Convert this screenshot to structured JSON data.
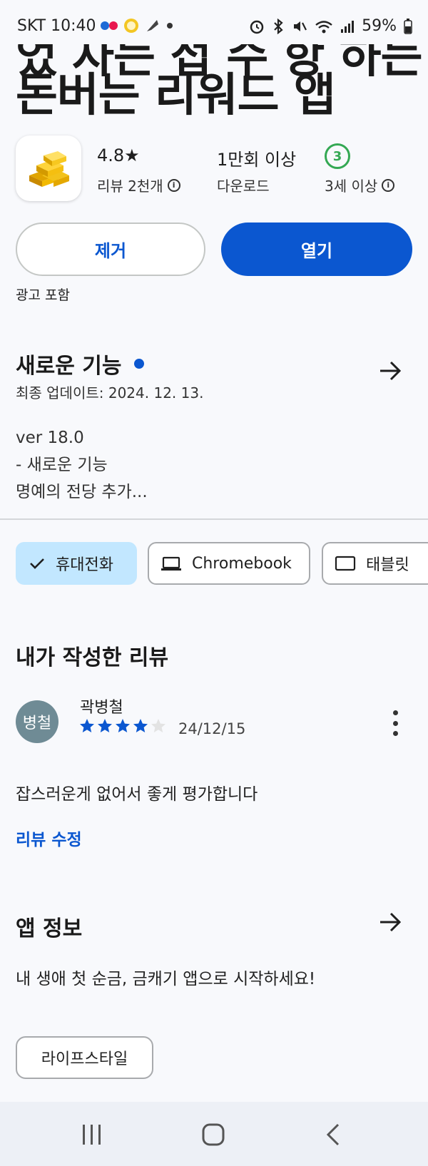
{
  "status_bar": {
    "carrier_time": "SKT 10:40",
    "battery": "59%"
  },
  "app": {
    "title_line1": "었 자는 접 수 항 하는",
    "title_line2": "돈버는 리워드 앱",
    "icon": "gold-bars-icon"
  },
  "stats": {
    "rating": "4.8★",
    "reviews": "리뷰 2천개",
    "downloads": "1만회 이상",
    "downloads_label": "다운로드",
    "age_number": "3",
    "age_label": "3세 이상"
  },
  "actions": {
    "remove_label": "제거",
    "open_label": "열기"
  },
  "ads_label": "광고 포함",
  "whats_new": {
    "title": "새로운 기능",
    "updated": "최종 업데이트: 2024. 12. 13.",
    "notes": [
      "ver 18.0",
      "- 새로운 기능",
      "명예의 전당 추가..."
    ]
  },
  "device_chips": [
    {
      "label": "휴대전화",
      "selected": true,
      "icon": "check-icon"
    },
    {
      "label": "Chromebook",
      "selected": false,
      "icon": "laptop-icon"
    },
    {
      "label": "태블릿",
      "selected": false,
      "icon": "tablet-icon"
    }
  ],
  "my_review": {
    "title": "내가 작성한 리뷰",
    "avatar_text": "병철",
    "reviewer": "곽병철",
    "rating": 4,
    "max_rating": 5,
    "date": "24/12/15",
    "text": "잡스러운게 없어서 좋게 평가합니다",
    "edit_label": "리뷰 수정"
  },
  "app_info": {
    "title": "앱 정보",
    "description": "내 생애 첫 순금, 금캐기 앱으로 시작하세요!",
    "category": "라이프스타일"
  },
  "colors": {
    "accent": "#0b57d0",
    "chip_selected": "#c2e7ff",
    "age_badge": "#34a853",
    "avatar": "#6f8b95"
  }
}
